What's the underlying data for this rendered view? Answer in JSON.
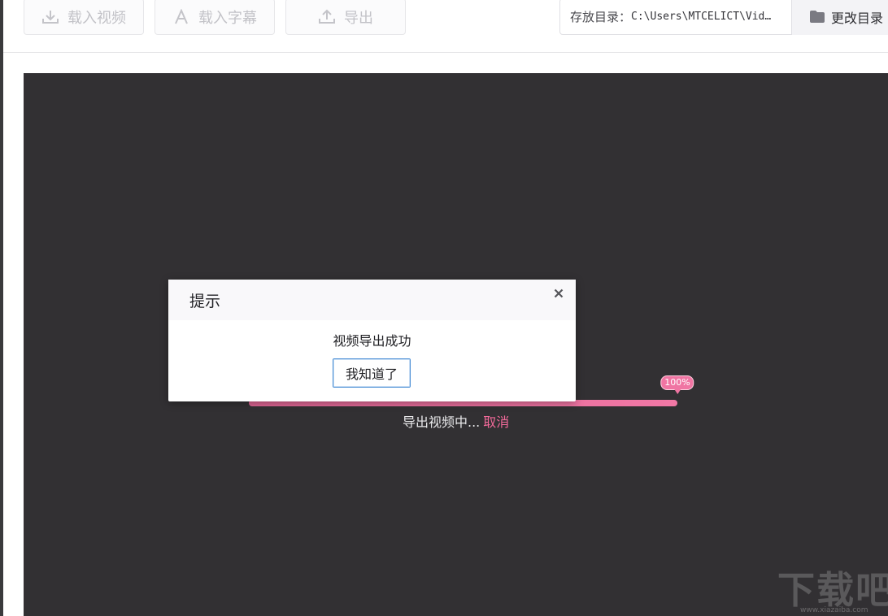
{
  "toolbar": {
    "load_video_label": "载入视频",
    "load_subtitle_label": "载入字幕",
    "export_label": "导出",
    "save_dir_label": "存放目录：",
    "save_dir_value": "C:\\Users\\MTCELICT\\Vid…",
    "change_dir_label": "更改目录"
  },
  "export": {
    "progress_percent": 100,
    "progress_label": "100%",
    "status_text": "导出视频中...",
    "cancel_label": "取消"
  },
  "dialog": {
    "title": "提示",
    "close_glyph": "✕",
    "message": "视频导出成功",
    "ok_label": "我知道了"
  },
  "watermark": {
    "text": "下载吧",
    "url": "www.xiazaiba.com"
  },
  "colors": {
    "accent_pink": "#f26a9a",
    "player_bg": "#323033",
    "dialog_button_border": "#4b8fd6"
  }
}
